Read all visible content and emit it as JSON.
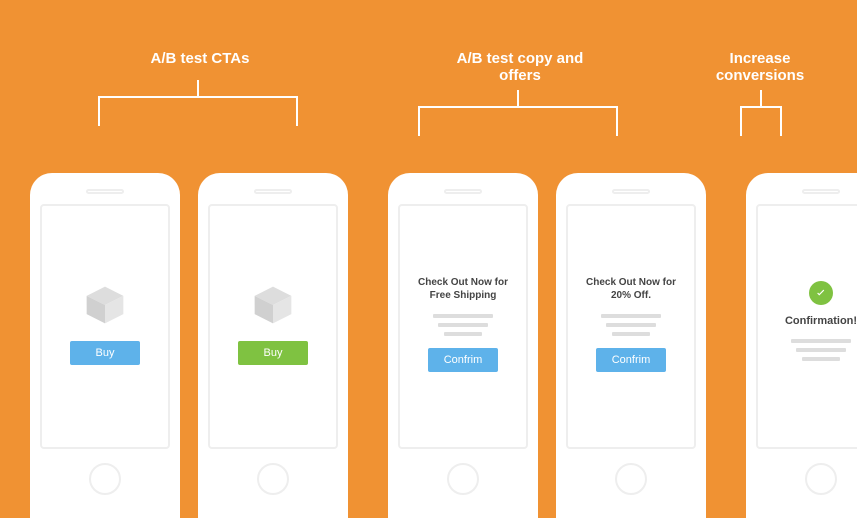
{
  "labels": {
    "group1": "A/B test CTAs",
    "group2": "A/B test copy and offers",
    "group3": "Increase conversions"
  },
  "phones": {
    "p1": {
      "button": "Buy",
      "button_color": "#5eb2ea"
    },
    "p2": {
      "button": "Buy",
      "button_color": "#7fc241"
    },
    "p3": {
      "headline": "Check Out Now for Free Shipping",
      "button": "Confrim"
    },
    "p4": {
      "headline": "Check Out Now for 20% Off.",
      "button": "Confrim"
    },
    "p5": {
      "headline": "Confirmation!"
    }
  },
  "colors": {
    "background": "#f09233",
    "blue": "#5eb2ea",
    "green": "#7fc241"
  }
}
